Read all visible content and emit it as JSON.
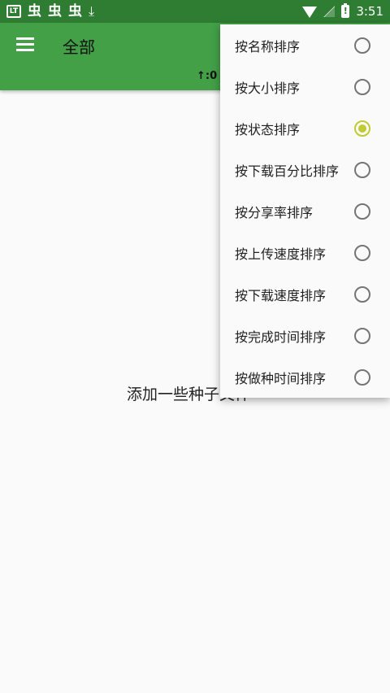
{
  "status_bar": {
    "time": "3:51",
    "icons": [
      "notification-box-icon",
      "bug-icon",
      "bug-icon",
      "bug-icon",
      "download-icon",
      "wifi-icon",
      "no-signal-icon",
      "battery-alert-icon"
    ],
    "box_icon_text": "LT",
    "bug_glyph": "虫",
    "download_glyph": "⤓"
  },
  "app_bar": {
    "title": "全部",
    "speed_text": "↑:0"
  },
  "main": {
    "empty_message": "添加一些种子文件"
  },
  "sort_menu": {
    "items": [
      {
        "label": "按名称排序",
        "checked": false
      },
      {
        "label": "按大小排序",
        "checked": false
      },
      {
        "label": "按状态排序",
        "checked": true
      },
      {
        "label": "按下载百分比排序",
        "checked": false
      },
      {
        "label": "按分享率排序",
        "checked": false
      },
      {
        "label": "按上传速度排序",
        "checked": false
      },
      {
        "label": "按下载速度排序",
        "checked": false
      },
      {
        "label": "按完成时间排序",
        "checked": false
      },
      {
        "label": "按做种时间排序",
        "checked": false
      }
    ]
  },
  "colors": {
    "status_bar": "#2e7d32",
    "app_bar": "#43a047",
    "radio_checked": "#c0ca33",
    "radio_unchecked": "#757575"
  }
}
